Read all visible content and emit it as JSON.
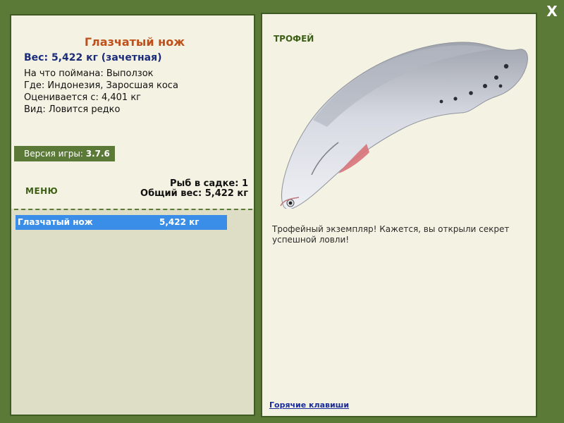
{
  "window": {
    "close_label": "X"
  },
  "fish": {
    "name": "Глазчатый нож",
    "weight_line": "Вес: 5,422 кг (зачетная)",
    "caught_with": "На что поймана: Выползок",
    "location": "Где: Индонезия, Заросшая коса",
    "rated_from": "Оценивается с: 4,401 кг",
    "rarity": "Вид: Ловится редко"
  },
  "version": {
    "label": "Версия игры:",
    "value": "3.7.6"
  },
  "menu": {
    "label": "МЕНЮ"
  },
  "cage": {
    "count_line": "Рыб в садке: 1",
    "total_line": "Общий вес: 5,422 кг",
    "items": [
      {
        "name": "Глазчатый нож",
        "weight": "5,422 кг"
      }
    ]
  },
  "trophy": {
    "label": "ТРОФЕЙ",
    "description": "Трофейный экземпляр! Кажется, вы открыли секрет успешной ловли!"
  },
  "hotkeys": {
    "label": "Горячие клавиши"
  },
  "colors": {
    "background": "#5b7a38",
    "panel": "#f4f3e3",
    "title": "#c0501a",
    "weight": "#1b2c7c",
    "selected_row": "#3a8ee8"
  }
}
